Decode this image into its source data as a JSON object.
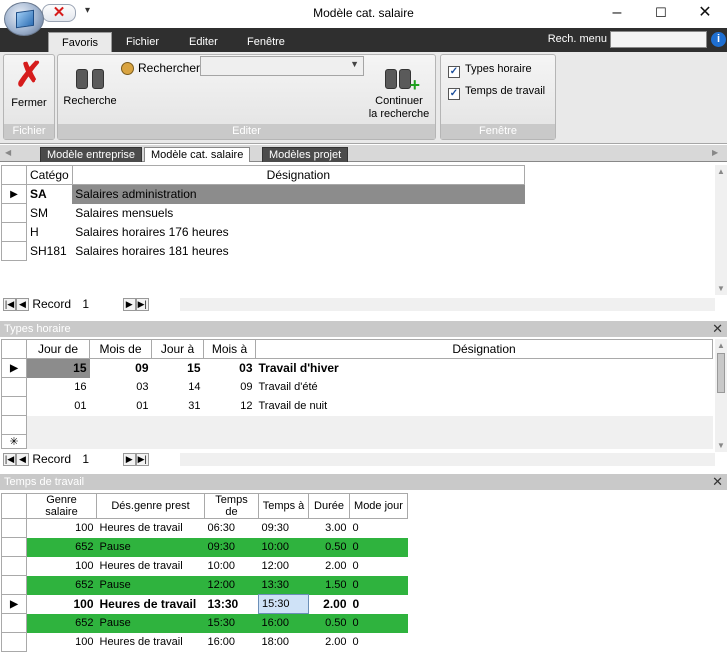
{
  "window": {
    "title": "Modèle cat. salaire",
    "minimize": "–",
    "maximize": "☐",
    "close": "✕"
  },
  "ribbon": {
    "tabs": [
      "Favoris",
      "Fichier",
      "Editer",
      "Fenêtre"
    ],
    "active_tab": "Favoris",
    "search_menu_label": "Rech. menu",
    "groups": {
      "fichier": {
        "label": "Fichier",
        "close_label": "Fermer"
      },
      "editer": {
        "label": "Editer",
        "recherche_label": "Recherche",
        "rechercher_label": "Rechercher",
        "rechercher_value": "",
        "continuer_line1": "Continuer",
        "continuer_line2": "la recherche"
      },
      "fenetre": {
        "label": "Fenêtre",
        "types_horaire": "Types horaire",
        "temps_de_travail": "Temps de travail",
        "types_horaire_checked": true,
        "temps_de_travail_checked": true
      }
    }
  },
  "doc_tabs": [
    "Modèle entreprise",
    "Modèle cat. salaire",
    "Modèles projet"
  ],
  "active_doc_tab": "Modèle cat. salaire",
  "categories": {
    "headers": {
      "code": "Catégo",
      "designation": "Désignation"
    },
    "rows": [
      {
        "code": "SA",
        "designation": "Salaires administration",
        "current": true
      },
      {
        "code": "SM",
        "designation": "Salaires mensuels"
      },
      {
        "code": "H",
        "designation": "Salaires horaires 176 heures"
      },
      {
        "code": "SH181",
        "designation": "Salaires horaires 181 heures"
      }
    ],
    "nav": {
      "label": "Record",
      "value": "1"
    }
  },
  "types_horaire": {
    "title": "Types horaire",
    "headers": {
      "jour_de": "Jour de",
      "mois_de": "Mois de",
      "jour_a": "Jour à",
      "mois_a": "Mois à",
      "designation": "Désignation"
    },
    "rows": [
      {
        "jour_de": "15",
        "mois_de": "09",
        "jour_a": "15",
        "mois_a": "03",
        "designation": "Travail d'hiver",
        "current": true
      },
      {
        "jour_de": "16",
        "mois_de": "03",
        "jour_a": "14",
        "mois_a": "09",
        "designation": "Travail d'été"
      },
      {
        "jour_de": "01",
        "mois_de": "01",
        "jour_a": "31",
        "mois_a": "12",
        "designation": "Travail de nuit"
      }
    ],
    "nav": {
      "label": "Record",
      "value": "1"
    }
  },
  "temps_de_travail": {
    "title": "Temps de travail",
    "headers": {
      "genre": "Genre salaire",
      "des": "Dés.genre prest",
      "de": "Temps de",
      "a": "Temps à",
      "duree": "Durée",
      "mode": "Mode jour"
    },
    "rows": [
      {
        "genre": "100",
        "des": "Heures de travail",
        "de": "06:30",
        "a": "09:30",
        "duree": "3.00",
        "mode": "0"
      },
      {
        "genre": "652",
        "des": "Pause",
        "de": "09:30",
        "a": "10:00",
        "duree": "0.50",
        "mode": "0",
        "green": true
      },
      {
        "genre": "100",
        "des": "Heures de travail",
        "de": "10:00",
        "a": "12:00",
        "duree": "2.00",
        "mode": "0"
      },
      {
        "genre": "652",
        "des": "Pause",
        "de": "12:00",
        "a": "13:30",
        "duree": "1.50",
        "mode": "0",
        "green": true
      },
      {
        "genre": "100",
        "des": "Heures de travail",
        "de": "13:30",
        "a": "15:30",
        "duree": "2.00",
        "mode": "0",
        "current": true
      },
      {
        "genre": "652",
        "des": "Pause",
        "de": "15:30",
        "a": "16:00",
        "duree": "0.50",
        "mode": "0",
        "green": true
      },
      {
        "genre": "100",
        "des": "Heures de travail",
        "de": "16:00",
        "a": "18:00",
        "duree": "2.00",
        "mode": "0"
      }
    ]
  },
  "colors": {
    "accent_green": "#2fb33e",
    "selected_gray": "#8c8c8c",
    "tab_bar": "#2f2f2f"
  }
}
